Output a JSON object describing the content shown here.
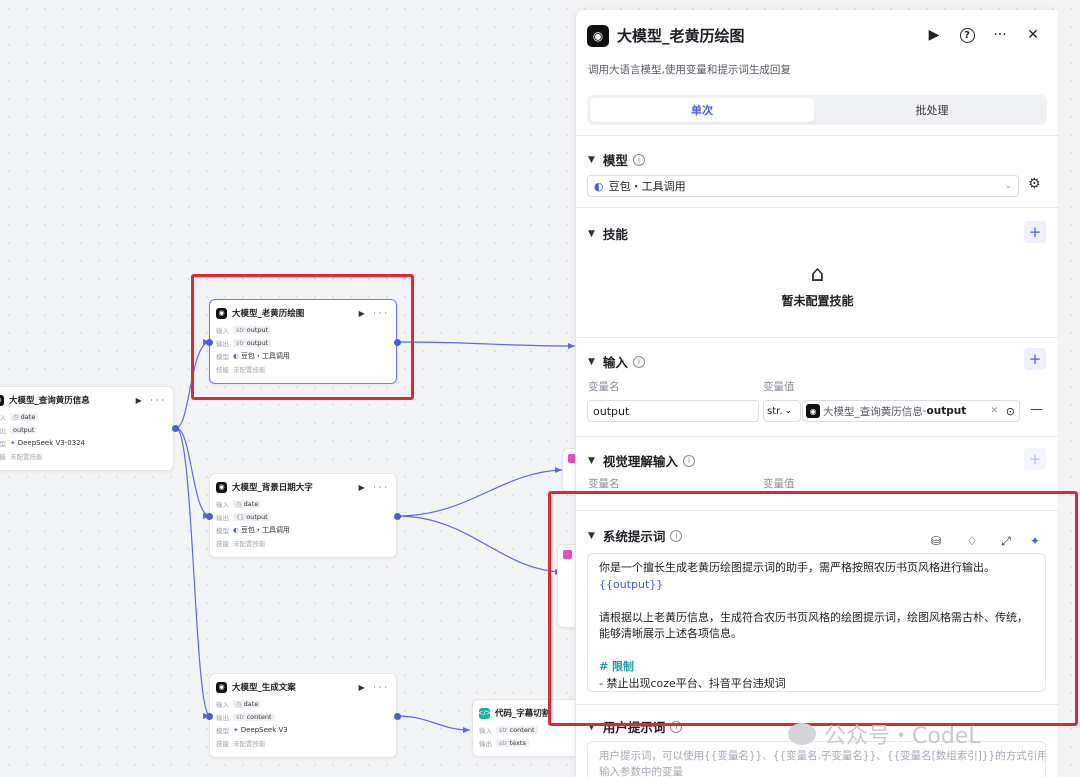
{
  "nodes": {
    "calendar_draw": {
      "title": "大模型_老黄历绘图",
      "input_label": "输入",
      "input_type": "str",
      "input_value": "output",
      "output_label": "输出",
      "output_type": "str",
      "output_value": "output",
      "model_label": "模型",
      "model_value": "豆包・工具调用",
      "skill_label": "技能",
      "skill_value": "未配置技能"
    },
    "calendar_query": {
      "title": "大模型_查询黄历信息",
      "input_label": "输入",
      "input_value": "date",
      "output_label": "输出",
      "output_value": "output",
      "model_label": "模型",
      "model_value": "DeepSeek V3-0324",
      "skill_label": "技能",
      "skill_value": "未配置技能"
    },
    "bg_date": {
      "title": "大模型_背景日期大字",
      "input_label": "输入",
      "input_value": "date",
      "output_label": "输出",
      "output_type": "{}",
      "output_value": "output",
      "model_label": "模型",
      "model_value": "豆包・工具调用",
      "skill_label": "技能",
      "skill_value": "未配置技能"
    },
    "copywrite": {
      "title": "大模型_生成文案",
      "input_label": "输入",
      "input_value": "date",
      "output_label": "输出",
      "output_type": "str",
      "output_value": "content",
      "model_label": "模型",
      "model_value": "DeepSeek V3",
      "skill_label": "技能",
      "skill_value": "未配置技能"
    },
    "code_subtitle": {
      "title": "代码_字幕切割",
      "input_label": "输入",
      "input_type": "str",
      "input_value": "content",
      "output_label": "输出",
      "output_type": "str",
      "output_value": "texts"
    }
  },
  "panel": {
    "title": "大模型_老黄历绘图",
    "description": "调用大语言模型,使用变量和提示词生成回复",
    "tabs": [
      "单次",
      "批处理"
    ],
    "model": {
      "section_title": "模型",
      "selected": "豆包・工具调用"
    },
    "skills": {
      "section_title": "技能",
      "empty_text": "暂未配置技能"
    },
    "input": {
      "section_title": "输入",
      "col_name": "变量名",
      "col_value": "变量值",
      "var_name": "output",
      "var_type": "str.",
      "ref_node": "大模型_查询黄历信息",
      "ref_field": "output",
      "ref_sep": " - "
    },
    "vision": {
      "section_title": "视觉理解输入",
      "col_name": "变量名",
      "col_value": "变量值"
    },
    "system_prompt": {
      "section_title": "系统提示词",
      "lines": [
        "你是一个擅长生成老黄历绘图提示词的助手，需严格按照农历书页风格进行输出。",
        "{{output}}",
        "",
        "请根据以上老黄历信息，生成符合农历书页风格的绘图提示词，绘图风格需古朴、传统，",
        "能够清晰展示上述各项信息。",
        "",
        "# 限制",
        "- 禁止出现coze平台、抖音平台违规词"
      ]
    },
    "user_prompt": {
      "section_title": "用户提示词",
      "placeholder_line1": "用户提示词，可以使用{{变量名}}、{{变量名.子变量名}}、{{变量名[数组索引]}}的方式引用",
      "placeholder_line2": "输入参数中的变量"
    }
  },
  "watermark": "公众号・CodeL",
  "colors": {
    "accent": "#4d5be6",
    "highlight_box": "#e8262d",
    "heading_teal": "#16a3a4"
  }
}
